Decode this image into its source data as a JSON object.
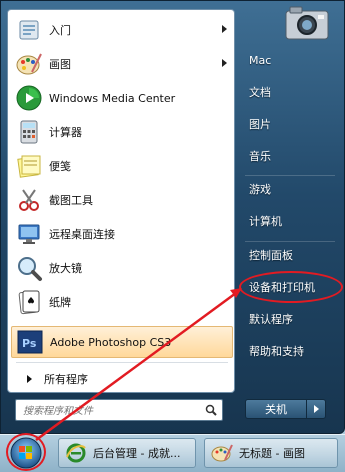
{
  "programs": [
    {
      "label": "入门",
      "icon": "getting-started-icon",
      "has_submenu": true
    },
    {
      "label": "画图",
      "icon": "paint-icon",
      "has_submenu": true
    },
    {
      "label": "Windows Media Center",
      "icon": "media-center-icon",
      "has_submenu": false
    },
    {
      "label": "计算器",
      "icon": "calculator-icon",
      "has_submenu": false
    },
    {
      "label": "便笺",
      "icon": "sticky-notes-icon",
      "has_submenu": false
    },
    {
      "label": "截图工具",
      "icon": "snipping-tool-icon",
      "has_submenu": false
    },
    {
      "label": "远程桌面连接",
      "icon": "remote-desktop-icon",
      "has_submenu": false
    },
    {
      "label": "放大镜",
      "icon": "magnifier-icon",
      "has_submenu": false
    },
    {
      "label": "纸牌",
      "icon": "solitaire-icon",
      "has_submenu": false
    },
    {
      "label": "Adobe Photoshop CS3",
      "icon": "photoshop-icon",
      "has_submenu": false
    }
  ],
  "all_programs": "所有程序",
  "search": {
    "placeholder": "搜索程序和文件"
  },
  "right_items": [
    "Mac",
    "文档",
    "图片",
    "音乐",
    "游戏",
    "计算机",
    "控制面板",
    "设备和打印机",
    "默认程序",
    "帮助和支持"
  ],
  "shutdown_label": "关机",
  "taskbar": {
    "items": [
      {
        "label": "后台管理 - 成就...",
        "icon": "ie-icon"
      },
      {
        "label": "无标题 - 画图",
        "icon": "paint-icon"
      }
    ]
  },
  "colors": {
    "highlight_annotation": "#e21b22",
    "photoshop_blue": "#1c3f7a"
  }
}
